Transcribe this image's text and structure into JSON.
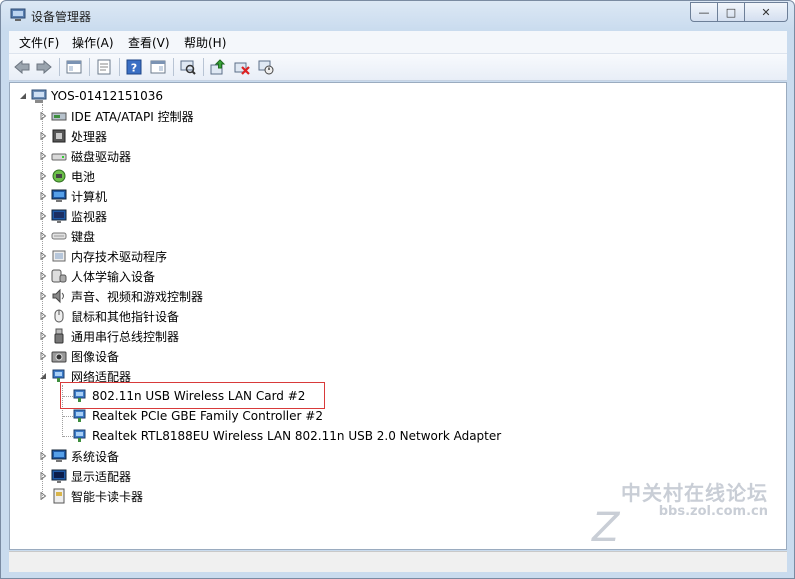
{
  "window": {
    "title": "设备管理器",
    "controls": {
      "minimize": "—",
      "maximize": "□",
      "close": "✕"
    }
  },
  "menu": [
    "文件(F)",
    "操作(A)",
    "查看(V)",
    "帮助(H)"
  ],
  "toolbar": [
    "back-arrow",
    "forward-arrow",
    "console-tree",
    "properties",
    "help",
    "view-pane",
    "scan-hardware",
    "update-driver",
    "uninstall",
    "disable"
  ],
  "tree": {
    "root": "YOS-01412151036",
    "categories": [
      {
        "label": "IDE ATA/ATAPI 控制器",
        "icon": "ide-controller-icon"
      },
      {
        "label": "处理器",
        "icon": "processor-icon"
      },
      {
        "label": "磁盘驱动器",
        "icon": "disk-drive-icon"
      },
      {
        "label": "电池",
        "icon": "battery-icon"
      },
      {
        "label": "计算机",
        "icon": "computer-icon"
      },
      {
        "label": "监视器",
        "icon": "monitor-icon"
      },
      {
        "label": "键盘",
        "icon": "keyboard-icon"
      },
      {
        "label": "内存技术驱动程序",
        "icon": "memory-tech-icon"
      },
      {
        "label": "人体学输入设备",
        "icon": "hid-icon"
      },
      {
        "label": "声音、视频和游戏控制器",
        "icon": "sound-icon"
      },
      {
        "label": "鼠标和其他指针设备",
        "icon": "mouse-icon"
      },
      {
        "label": "通用串行总线控制器",
        "icon": "usb-icon"
      },
      {
        "label": "图像设备",
        "icon": "imaging-icon"
      },
      {
        "label": "网络适配器",
        "icon": "network-adapter-icon",
        "expanded": true,
        "children": [
          "802.11n USB Wireless LAN Card #2",
          "Realtek PCIe GBE Family Controller #2",
          "Realtek RTL8188EU Wireless LAN 802.11n USB 2.0 Network Adapter"
        ]
      },
      {
        "label": "系统设备",
        "icon": "system-devices-icon"
      },
      {
        "label": "显示适配器",
        "icon": "display-adapter-icon"
      },
      {
        "label": "智能卡读卡器",
        "icon": "smart-card-reader-icon"
      }
    ]
  },
  "watermark": {
    "main": "中关村在线论坛",
    "sub": "bbs.zol.com.cn"
  }
}
